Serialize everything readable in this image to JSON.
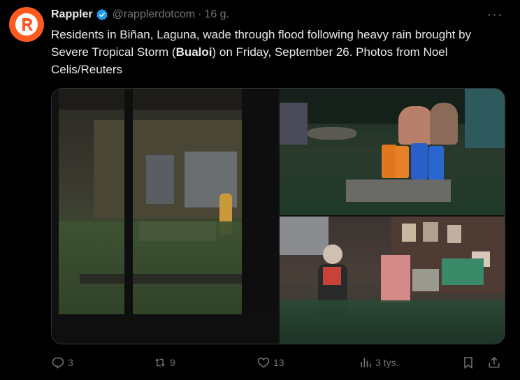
{
  "tweet": {
    "display_name": "Rappler",
    "handle": "@rapplerdotcom",
    "separator": "·",
    "time": "16 g.",
    "text_before": "Residents in Biñan, Laguna, wade through flood following heavy rain brought by Severe Tropical Storm (",
    "text_bold": "Bualoi",
    "text_after": ") on Friday, September 26. Photos from Noel Celis/Reuters",
    "more_label": "···"
  },
  "actions": {
    "replies": "3",
    "retweets": "9",
    "likes": "13",
    "views": "3 tys."
  },
  "icons": {
    "avatar": "rappler-logo-icon",
    "verified": "verified-badge-icon",
    "reply": "reply-icon",
    "retweet": "retweet-icon",
    "like": "heart-icon",
    "views": "views-chart-icon",
    "bookmark": "bookmark-icon",
    "share": "share-icon"
  },
  "colors": {
    "background": "#000000",
    "brand": "#ff5a1f",
    "verified": "#1d9bf0",
    "muted": "#71767b",
    "text": "#e7e9ea"
  }
}
